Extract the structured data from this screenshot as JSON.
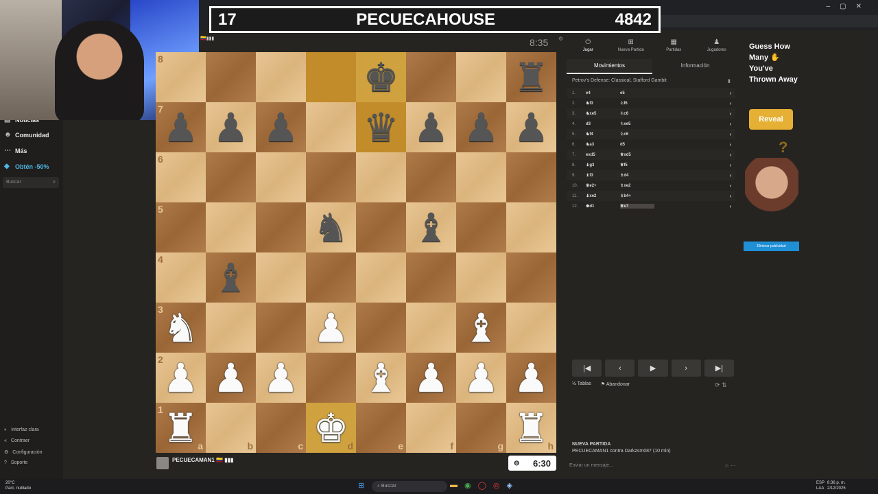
{
  "overlay": {
    "left": "17",
    "title": "PECUECAHOUSE",
    "right": "4842"
  },
  "webcam": {
    "alt": "streamer-webcam"
  },
  "sidebar": {
    "items": [
      {
        "label": "Noticias",
        "icon": "news-icon"
      },
      {
        "label": "Comunidad",
        "icon": "community-icon"
      },
      {
        "label": "Más",
        "icon": "more-icon"
      },
      {
        "label": "Obtén -50%",
        "icon": "diamond-icon",
        "color": "#4fb6e6"
      }
    ],
    "search_placeholder": "Buscar",
    "footer": [
      {
        "label": "Interfaz clara",
        "icon": "theme-icon"
      },
      {
        "label": "Contraer",
        "icon": "collapse-icon"
      },
      {
        "label": "Configuración",
        "icon": "gear-icon"
      },
      {
        "label": "Soporte",
        "icon": "help-icon"
      }
    ]
  },
  "board": {
    "opponent_clock": "8:35",
    "ranks": [
      "8",
      "7",
      "6",
      "5",
      "4",
      "3",
      "2",
      "1"
    ],
    "files": [
      "a",
      "b",
      "c",
      "d",
      "e",
      "f",
      "g",
      "h"
    ],
    "position": [
      [
        "",
        "",
        "",
        "",
        "bK",
        "",
        "",
        "bR"
      ],
      [
        "bP",
        "bP",
        "bP",
        "",
        "bQ",
        "bP",
        "bP",
        "bP"
      ],
      [
        "",
        "",
        "",
        "",
        "",
        "",
        "",
        ""
      ],
      [
        "",
        "",
        "",
        "bN",
        "",
        "bB",
        "",
        ""
      ],
      [
        "",
        "bB",
        "",
        "",
        "",
        "",
        "",
        ""
      ],
      [
        "wN",
        "",
        "",
        "wP",
        "",
        "",
        "wB",
        ""
      ],
      [
        "wP",
        "wP",
        "wP",
        "",
        "wB",
        "wP",
        "wP",
        "wP"
      ],
      [
        "wR",
        "",
        "",
        "wK",
        "",
        "",
        "",
        "wR"
      ]
    ],
    "highlighted": [
      "d8",
      "e8",
      "e7",
      "d1"
    ],
    "player_name": "PECUECAMAN1",
    "player_flags": "🇨🇴 ▮▮▮",
    "player_rating": "",
    "my_clock": "6:30"
  },
  "panel": {
    "tabs": [
      {
        "label": "Jugar",
        "icon": "play-icon",
        "active": true
      },
      {
        "label": "Nueva Partida",
        "icon": "new-game-icon",
        "active": false
      },
      {
        "label": "Partidas",
        "icon": "games-icon",
        "active": false
      },
      {
        "label": "Jugadores",
        "icon": "players-icon",
        "active": false
      }
    ],
    "subtabs": [
      {
        "label": "Movimientos",
        "active": true
      },
      {
        "label": "Información",
        "active": false
      }
    ],
    "opening": "Petrov's Defense: Classical, Stafford Gambit",
    "moves": [
      {
        "num": "1.",
        "white": "e4",
        "black": "e5"
      },
      {
        "num": "2.",
        "white": "♞f3",
        "black": "♘f6"
      },
      {
        "num": "3.",
        "white": "♞xe5",
        "black": "♘c6"
      },
      {
        "num": "4.",
        "white": "d3",
        "black": "♘xe5"
      },
      {
        "num": "5.",
        "white": "♞f4",
        "black": "♘c6"
      },
      {
        "num": "6.",
        "white": "♞a3",
        "black": "d5"
      },
      {
        "num": "7.",
        "white": "exd5",
        "black": "♕xd5"
      },
      {
        "num": "8.",
        "white": "♝g3",
        "black": "♕f5"
      },
      {
        "num": "9.",
        "white": "♝f3",
        "black": "♗d4"
      },
      {
        "num": "10.",
        "white": "♛e2+",
        "black": "♗xe2"
      },
      {
        "num": "11.",
        "white": "♝xe2",
        "black": "♗b4+"
      },
      {
        "num": "12.",
        "white": "♚d1",
        "black": "♕e7"
      }
    ],
    "nav": [
      "⏮",
      "◀",
      "▶",
      "▷",
      "⏭"
    ],
    "actions": [
      {
        "label": "Tablas",
        "icon": "draw-icon"
      },
      {
        "label": "Abandonar",
        "icon": "resign-flag-icon"
      }
    ],
    "newgame_title": "NUEVA PARTIDA",
    "newgame_line": "PECUECAMAN1 contra Darkzsm087 (10 min)",
    "message_placeholder": "Enviar un mensaje..."
  },
  "ad": {
    "title": "Guess How Many ✋ You've Thrown Away",
    "button": "Reveal",
    "remove": "Eliminar publicidad"
  },
  "taskbar": {
    "weather_temp": "20°C",
    "weather_desc": "Parc. nublado",
    "search_placeholder": "Buscar",
    "lang": "ESP",
    "lang2": "LAA",
    "time": "8:36 p. m.",
    "date": "2/12/2025"
  }
}
